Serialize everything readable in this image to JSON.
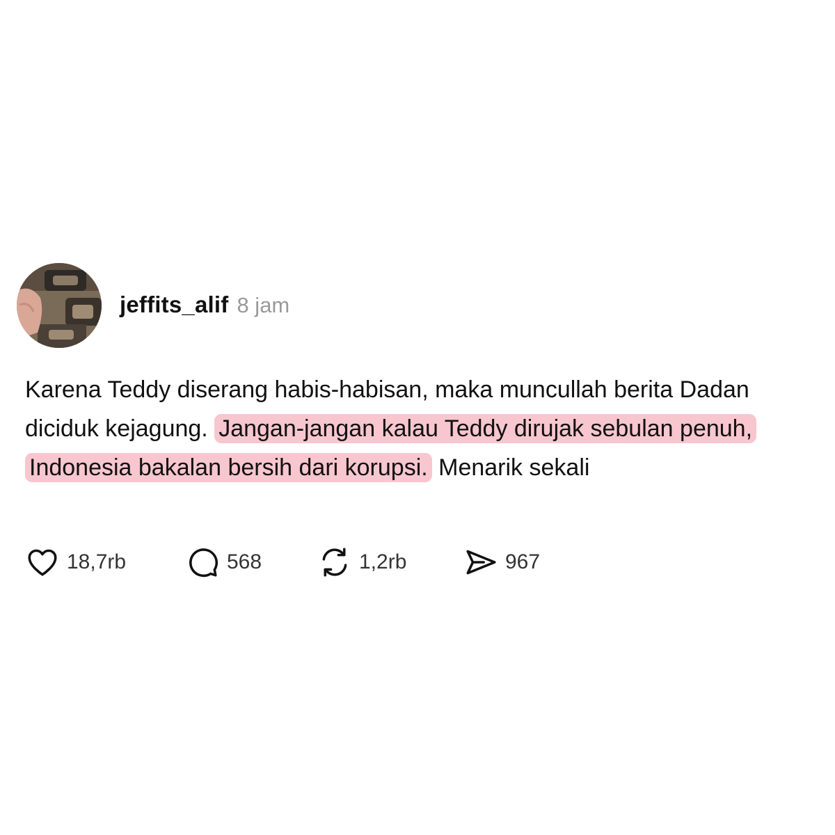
{
  "post": {
    "author": {
      "username": "jeffits_alif",
      "timestamp": "8 jam"
    },
    "body": {
      "text_before": "Karena Teddy diserang habis-habisan, maka muncullah berita Dadan diciduk kejagung. ",
      "highlighted_text": "Jangan-jangan kalau Teddy dirujak sebulan penuh, Indonesia bakalan bersih dari korupsi.",
      "text_after": " Menarik sekali"
    },
    "highlight_color": "#f8c6cf",
    "actions": {
      "like": {
        "icon": "heart-icon",
        "count": "18,7rb"
      },
      "reply": {
        "icon": "speech-bubble-icon",
        "count": "568"
      },
      "repost": {
        "icon": "repost-arrows-icon",
        "count": "1,2rb"
      },
      "share": {
        "icon": "paper-plane-icon",
        "count": "967"
      }
    }
  }
}
